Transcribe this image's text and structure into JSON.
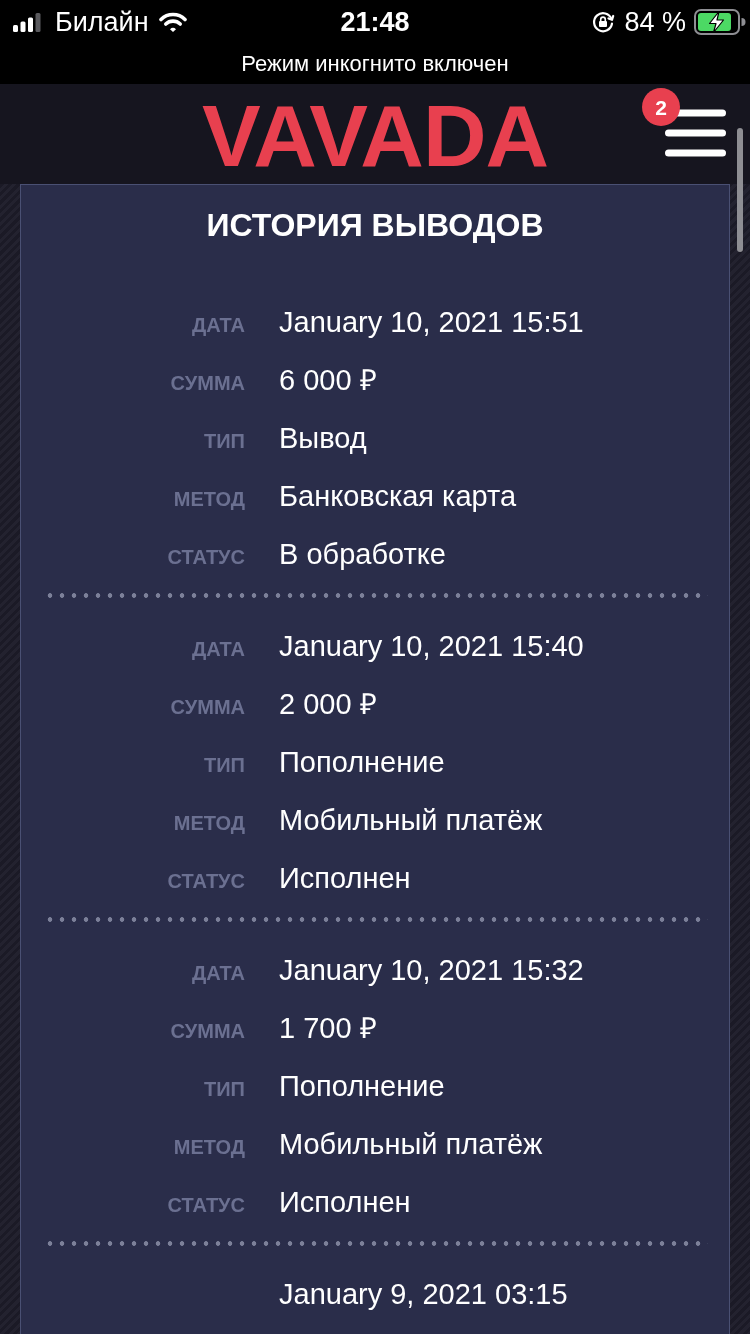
{
  "status_bar": {
    "carrier": "Билайн",
    "time": "21:48",
    "battery": "84 %"
  },
  "banner": {
    "text": "Режим инкогнито включен"
  },
  "header": {
    "logo": "VAVADA",
    "menu_badge": "2"
  },
  "history": {
    "title": "ИСТОРИЯ ВЫВОДОВ",
    "records": [
      {
        "fields": [
          {
            "label": "ДАТА",
            "value": "January 10, 2021 15:51"
          },
          {
            "label": "СУММА",
            "value": "6 000 ₽"
          },
          {
            "label": "ТИП",
            "value": "Вывод"
          },
          {
            "label": "МЕТОД",
            "value": "Банковская карта"
          },
          {
            "label": "СТАТУС",
            "value": "В обработке"
          }
        ]
      },
      {
        "fields": [
          {
            "label": "ДАТА",
            "value": "January 10, 2021 15:40"
          },
          {
            "label": "СУММА",
            "value": "2 000 ₽"
          },
          {
            "label": "ТИП",
            "value": "Пополнение"
          },
          {
            "label": "МЕТОД",
            "value": "Мобильный платёж"
          },
          {
            "label": "СТАТУС",
            "value": "Исполнен"
          }
        ]
      },
      {
        "fields": [
          {
            "label": "ДАТА",
            "value": "January 10, 2021 15:32"
          },
          {
            "label": "СУММА",
            "value": "1 700 ₽"
          },
          {
            "label": "ТИП",
            "value": "Пополнение"
          },
          {
            "label": "МЕТОД",
            "value": "Мобильный платёж"
          },
          {
            "label": "СТАТУС",
            "value": "Исполнен"
          }
        ]
      },
      {
        "fields": [
          {
            "value": "January 9, 2021 03:15"
          }
        ]
      }
    ]
  }
}
